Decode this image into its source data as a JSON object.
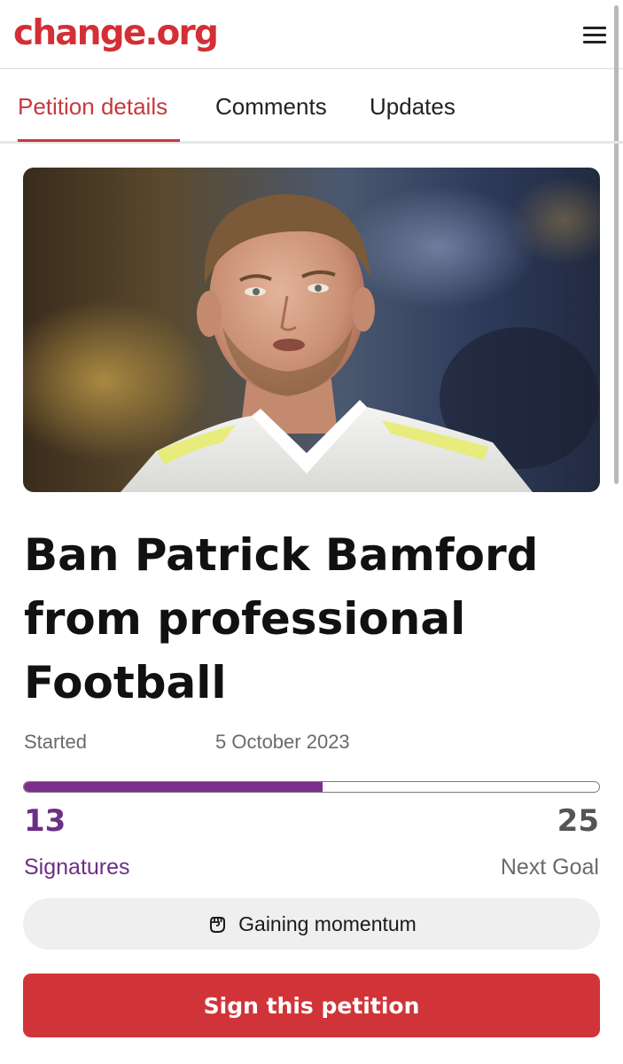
{
  "header": {
    "logo": "change.org",
    "menu_icon": "hamburger-menu-icon"
  },
  "tabs": [
    {
      "label": "Petition details",
      "active": true
    },
    {
      "label": "Comments",
      "active": false
    },
    {
      "label": "Updates",
      "active": false
    }
  ],
  "petition": {
    "image_alt": "Photo of a footballer in a white kit",
    "title": "Ban Patrick Bamford from professional Football",
    "started_label": "Started",
    "started_date": "5 October 2023",
    "signatures": "13",
    "signatures_label": "Signatures",
    "next_goal": "25",
    "next_goal_label": "Next Goal",
    "progress_fraction": 0.52,
    "momentum_icon": "raised-fist-icon",
    "momentum_text": "Gaining momentum",
    "sign_button": "Sign this petition"
  },
  "colors": {
    "brand": "#d32f35",
    "accent_purple": "#6c2f85",
    "sign_button": "#d13438"
  }
}
